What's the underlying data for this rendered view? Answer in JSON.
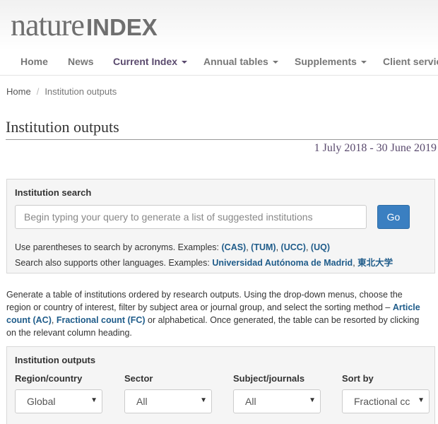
{
  "logo": {
    "nature": "nature",
    "index": "INDEX"
  },
  "nav": {
    "items": [
      {
        "label": "Home"
      },
      {
        "label": "News"
      },
      {
        "label": "Current Index"
      },
      {
        "label": "Annual tables"
      },
      {
        "label": "Supplements"
      },
      {
        "label": "Client servic"
      }
    ]
  },
  "breadcrumb": {
    "home": "Home",
    "separator": "/",
    "current": "Institution outputs"
  },
  "page": {
    "title": "Institution outputs",
    "date_range": "1 July 2018 - 30 June 2019"
  },
  "search": {
    "heading": "Institution search",
    "placeholder": "Begin typing your query to generate a list of suggested institutions",
    "go_label": "Go",
    "help1_prefix": "Use parentheses to search by acronyms. Examples: ",
    "acronyms": [
      "(CAS)",
      "(TUM)",
      "(UCC)",
      "(UQ)"
    ],
    "comma": ", ",
    "help2_prefix": "Search also supports other languages. Examples: ",
    "lang_example1": "Universidad Autónoma de Madrid",
    "lang_example2": "東北大学"
  },
  "intro": {
    "line1_text": "Generate a table of institutions ordered by research outputs. Using the drop-down menus, choose the",
    "line2_text": "region or country of interest, filter by subject area or journal group, and select the sorting method – ",
    "article_link_part1": "Article",
    "article_link_part2": "count (AC)",
    "comma": ", ",
    "fc_link": "Fractional count (FC)",
    "line3_text": " or alphabetical. Once generated, the table can be resorted by clicking",
    "line4_text": "on the relevant column heading."
  },
  "outputs": {
    "heading": "Institution outputs",
    "filters": [
      {
        "label": "Region/country",
        "value": "Global"
      },
      {
        "label": "Sector",
        "value": "All"
      },
      {
        "label": "Subject/journals",
        "value": "All"
      },
      {
        "label": "Sort by",
        "value": "Fractional cc"
      }
    ],
    "arrow_glyph": "▼"
  },
  "colors": {
    "accent": "#5a4a6e",
    "link": "#1f5c8a",
    "button": "#3a7fc1"
  }
}
